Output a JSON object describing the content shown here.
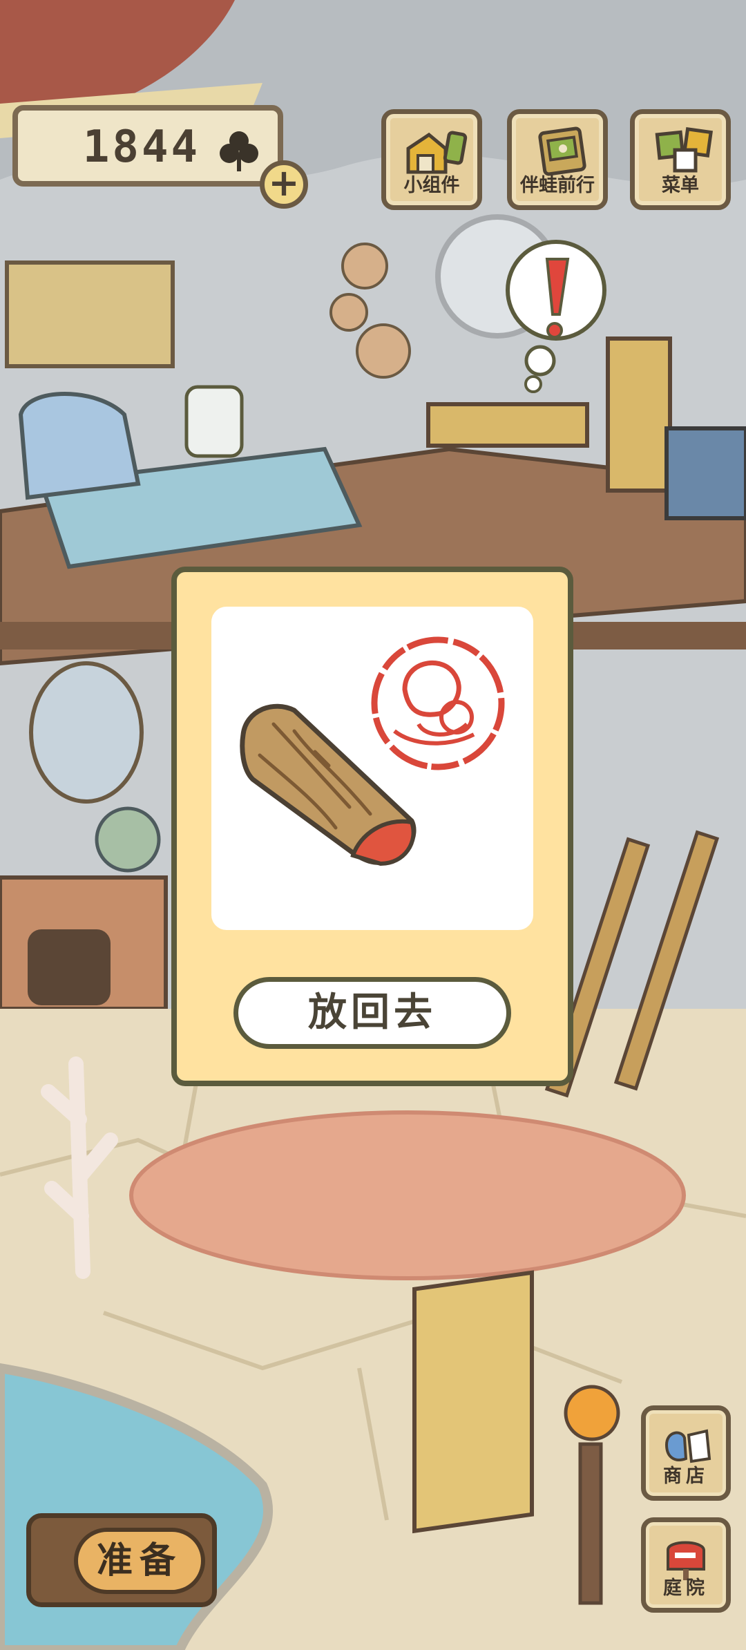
{
  "currency": {
    "clover_count": "1844",
    "icon": "clover-icon",
    "add_icon": "plus-icon"
  },
  "top_menu": [
    {
      "label": "小组件",
      "icon": "widget-icon"
    },
    {
      "label": "伴蛙前行",
      "icon": "frog-journey-icon"
    },
    {
      "label": "菜单",
      "icon": "menu-icon"
    }
  ],
  "notification": {
    "icon": "exclamation-icon"
  },
  "dialog": {
    "item_icon": "wood-log-icon",
    "stamp_icon": "frog-stamp-icon",
    "put_back_label": "放回去"
  },
  "bottom": {
    "prepare_label": "准备",
    "shop_label": "商店",
    "yard_label": "庭院"
  },
  "colors": {
    "dialog_bg": "#ffe2a0",
    "border": "#5b5b3d",
    "button_wood": "#e6cf9d"
  }
}
